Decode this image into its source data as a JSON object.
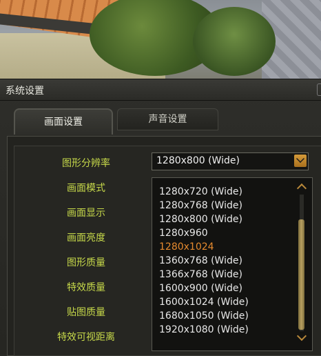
{
  "window": {
    "title": "系统设置"
  },
  "tabs": [
    {
      "label": "画面设置",
      "active": true
    },
    {
      "label": "声音设置",
      "active": false
    }
  ],
  "settings_labels": [
    "图形分辨率",
    "画面模式",
    "画面显示",
    "画面亮度",
    "图形质量",
    "特效质量",
    "贴图质量",
    "特效可视距离"
  ],
  "resolution": {
    "selected": "1280x800 (Wide)",
    "options": [
      "1280x720 (Wide)",
      "1280x768 (Wide)",
      "1280x800 (Wide)",
      "1280x960",
      "1280x1024",
      "1360x768 (Wide)",
      "1366x768 (Wide)",
      "1600x900 (Wide)",
      "1600x1024 (Wide)",
      "1680x1050 (Wide)",
      "1920x1080 (Wide)"
    ],
    "highlighted": "1280x1024"
  },
  "icons": [
    "chevron-down-icon",
    "scroll-up-icon",
    "scroll-down-icon"
  ],
  "colors": {
    "label": "#c7d94a",
    "highlight": "#e68a2e",
    "accent": "#d49a3a"
  }
}
